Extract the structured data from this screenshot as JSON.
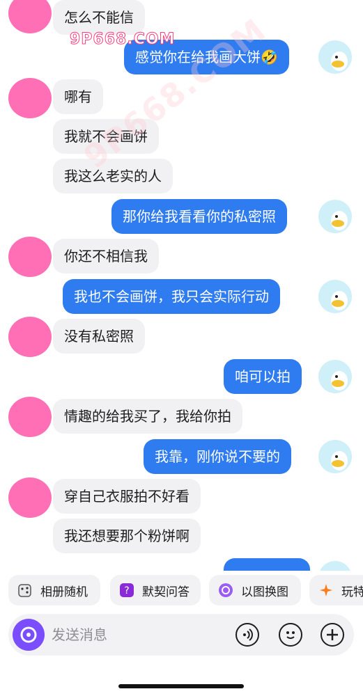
{
  "messages": [
    {
      "side": "in",
      "text": "怎么不能信"
    },
    {
      "side": "out",
      "text": "感觉你在给我画大饼🤣"
    },
    {
      "side": "in",
      "text": "哪有"
    },
    {
      "side": "in",
      "text": "我就不会画饼"
    },
    {
      "side": "in",
      "text": "我这么老实的人"
    },
    {
      "side": "out",
      "text": "那你给我看看你的私密照"
    },
    {
      "side": "in",
      "text": "你还不相信我"
    },
    {
      "side": "out",
      "text": "我也不会画饼，我只会实际行动"
    },
    {
      "side": "in",
      "text": "没有私密照"
    },
    {
      "side": "out",
      "text": "咱可以拍"
    },
    {
      "side": "in",
      "text": "情趣的给我买了，我给你拍"
    },
    {
      "side": "out",
      "text": "我靠，刚你说不要的"
    },
    {
      "side": "in",
      "text": "穿自己衣服拍不好看"
    },
    {
      "side": "in",
      "text": "我还想要那个粉饼啊"
    }
  ],
  "watermark": {
    "text": "9P668.COM",
    "text_diag": "9P668.COM"
  },
  "quick_actions": [
    {
      "label": "相册随机",
      "icon": "dice-icon"
    },
    {
      "label": "默契问答",
      "icon": "question-icon"
    },
    {
      "label": "以图换图",
      "icon": "swap-image-icon"
    },
    {
      "label": "玩特",
      "icon": "sparkle-icon"
    }
  ],
  "composer": {
    "placeholder": "发送消息"
  },
  "colors": {
    "outgoing_bubble": "#2f7bf0",
    "incoming_bubble": "#f1f1f3",
    "accent": "#7a4dff"
  }
}
